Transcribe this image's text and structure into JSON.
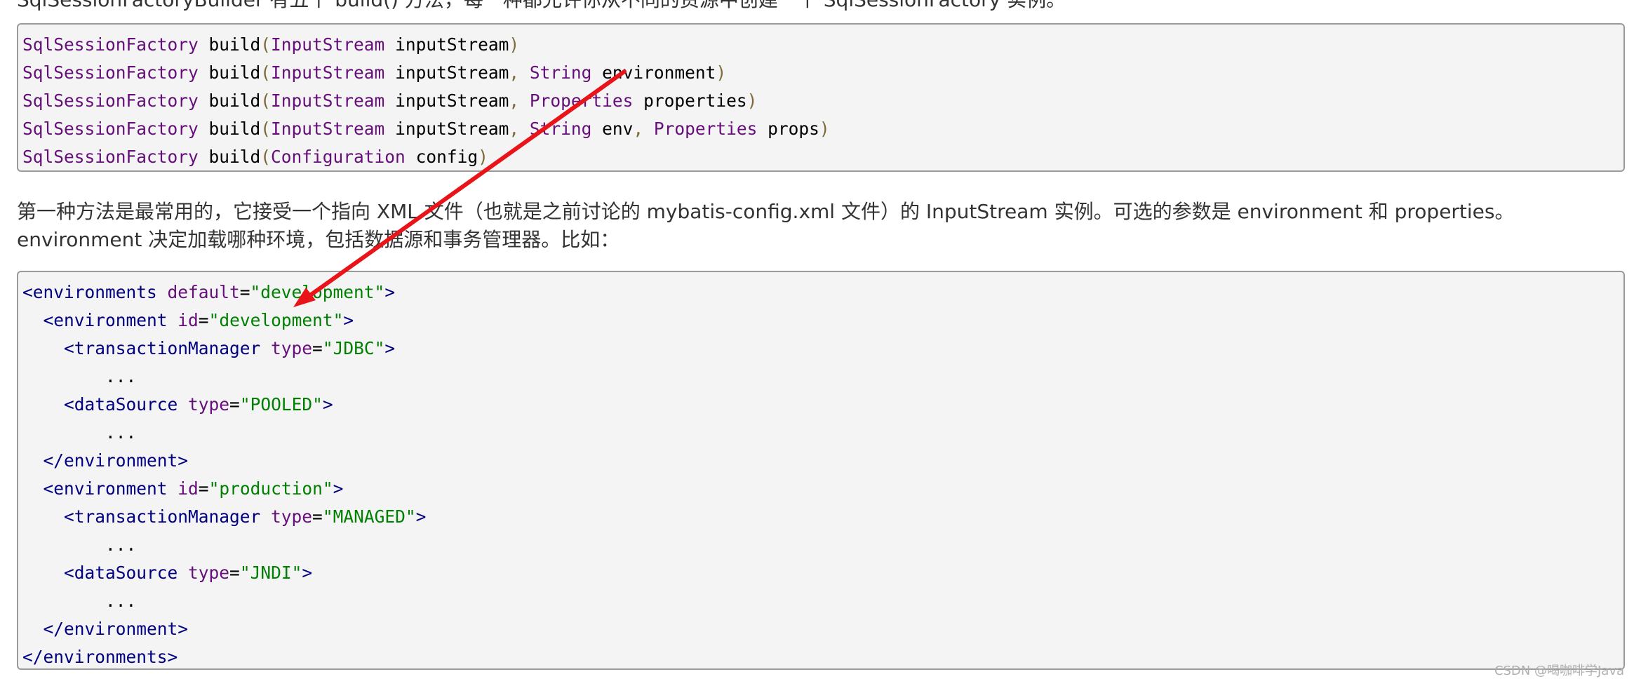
{
  "top_partial_text": "SqlSessionFactoryBuilder 有五个 build() 方法，每一种都允许你从不同的资源中创建一个 SqlSessionFactory 实例。",
  "code_block_1": {
    "lines": [
      [
        {
          "t": "type",
          "v": "SqlSessionFactory"
        },
        {
          "t": "plain",
          "v": " build"
        },
        {
          "t": "paren",
          "v": "("
        },
        {
          "t": "type",
          "v": "InputStream"
        },
        {
          "t": "plain",
          "v": " inputStream"
        },
        {
          "t": "paren",
          "v": ")"
        }
      ],
      [
        {
          "t": "type",
          "v": "SqlSessionFactory"
        },
        {
          "t": "plain",
          "v": " build"
        },
        {
          "t": "paren",
          "v": "("
        },
        {
          "t": "type",
          "v": "InputStream"
        },
        {
          "t": "plain",
          "v": " inputStream"
        },
        {
          "t": "comma",
          "v": ", "
        },
        {
          "t": "type",
          "v": "String"
        },
        {
          "t": "plain",
          "v": " environment"
        },
        {
          "t": "paren",
          "v": ")"
        }
      ],
      [
        {
          "t": "type",
          "v": "SqlSessionFactory"
        },
        {
          "t": "plain",
          "v": " build"
        },
        {
          "t": "paren",
          "v": "("
        },
        {
          "t": "type",
          "v": "InputStream"
        },
        {
          "t": "plain",
          "v": " inputStream"
        },
        {
          "t": "comma",
          "v": ", "
        },
        {
          "t": "type",
          "v": "Properties"
        },
        {
          "t": "plain",
          "v": " properties"
        },
        {
          "t": "paren",
          "v": ")"
        }
      ],
      [
        {
          "t": "type",
          "v": "SqlSessionFactory"
        },
        {
          "t": "plain",
          "v": " build"
        },
        {
          "t": "paren",
          "v": "("
        },
        {
          "t": "type",
          "v": "InputStream"
        },
        {
          "t": "plain",
          "v": " inputStream"
        },
        {
          "t": "comma",
          "v": ", "
        },
        {
          "t": "type",
          "v": "String"
        },
        {
          "t": "plain",
          "v": " env"
        },
        {
          "t": "comma",
          "v": ", "
        },
        {
          "t": "type",
          "v": "Properties"
        },
        {
          "t": "plain",
          "v": " props"
        },
        {
          "t": "paren",
          "v": ")"
        }
      ],
      [
        {
          "t": "type",
          "v": "SqlSessionFactory"
        },
        {
          "t": "plain",
          "v": " build"
        },
        {
          "t": "paren",
          "v": "("
        },
        {
          "t": "type",
          "v": "Configuration"
        },
        {
          "t": "plain",
          "v": " config"
        },
        {
          "t": "paren",
          "v": ")"
        }
      ]
    ]
  },
  "paragraph": "第一种方法是最常用的，它接受一个指向 XML 文件（也就是之前讨论的 mybatis-config.xml 文件）的 InputStream 实例。可选的参数是 environment 和 properties。environment 决定加载哪种环境，包括数据源和事务管理器。比如：",
  "code_block_2": {
    "lines": [
      [
        {
          "t": "tag",
          "v": "<environments "
        },
        {
          "t": "attr",
          "v": "default"
        },
        {
          "t": "eq",
          "v": "="
        },
        {
          "t": "val",
          "v": "\"development\""
        },
        {
          "t": "tag",
          "v": ">"
        }
      ],
      [
        {
          "t": "plain",
          "v": "  "
        },
        {
          "t": "tag",
          "v": "<environment "
        },
        {
          "t": "attr",
          "v": "id"
        },
        {
          "t": "eq",
          "v": "="
        },
        {
          "t": "val",
          "v": "\"development\""
        },
        {
          "t": "tag",
          "v": ">"
        }
      ],
      [
        {
          "t": "plain",
          "v": "    "
        },
        {
          "t": "tag",
          "v": "<transactionManager "
        },
        {
          "t": "attr",
          "v": "type"
        },
        {
          "t": "eq",
          "v": "="
        },
        {
          "t": "val",
          "v": "\"JDBC\""
        },
        {
          "t": "tag",
          "v": ">"
        }
      ],
      [
        {
          "t": "plain",
          "v": "        ..."
        }
      ],
      [
        {
          "t": "plain",
          "v": "    "
        },
        {
          "t": "tag",
          "v": "<dataSource "
        },
        {
          "t": "attr",
          "v": "type"
        },
        {
          "t": "eq",
          "v": "="
        },
        {
          "t": "val",
          "v": "\"POOLED\""
        },
        {
          "t": "tag",
          "v": ">"
        }
      ],
      [
        {
          "t": "plain",
          "v": "        ..."
        }
      ],
      [
        {
          "t": "plain",
          "v": "  "
        },
        {
          "t": "tag",
          "v": "</environment>"
        }
      ],
      [
        {
          "t": "plain",
          "v": "  "
        },
        {
          "t": "tag",
          "v": "<environment "
        },
        {
          "t": "attr",
          "v": "id"
        },
        {
          "t": "eq",
          "v": "="
        },
        {
          "t": "val",
          "v": "\"production\""
        },
        {
          "t": "tag",
          "v": ">"
        }
      ],
      [
        {
          "t": "plain",
          "v": "    "
        },
        {
          "t": "tag",
          "v": "<transactionManager "
        },
        {
          "t": "attr",
          "v": "type"
        },
        {
          "t": "eq",
          "v": "="
        },
        {
          "t": "val",
          "v": "\"MANAGED\""
        },
        {
          "t": "tag",
          "v": ">"
        }
      ],
      [
        {
          "t": "plain",
          "v": "        ..."
        }
      ],
      [
        {
          "t": "plain",
          "v": "    "
        },
        {
          "t": "tag",
          "v": "<dataSource "
        },
        {
          "t": "attr",
          "v": "type"
        },
        {
          "t": "eq",
          "v": "="
        },
        {
          "t": "val",
          "v": "\"JNDI\""
        },
        {
          "t": "tag",
          "v": ">"
        }
      ],
      [
        {
          "t": "plain",
          "v": "        ..."
        }
      ],
      [
        {
          "t": "plain",
          "v": "  "
        },
        {
          "t": "tag",
          "v": "</environment>"
        }
      ],
      [
        {
          "t": "tag",
          "v": "</environments>"
        }
      ]
    ]
  },
  "annotation": {
    "arrow_color": "#e8141a"
  },
  "watermark": "CSDN @喝咖啡学Java",
  "colors": {
    "code_background": "#f4f4f4",
    "type_keyword": "#660e7a",
    "xml_tag": "#000080",
    "xml_value": "#008000"
  }
}
